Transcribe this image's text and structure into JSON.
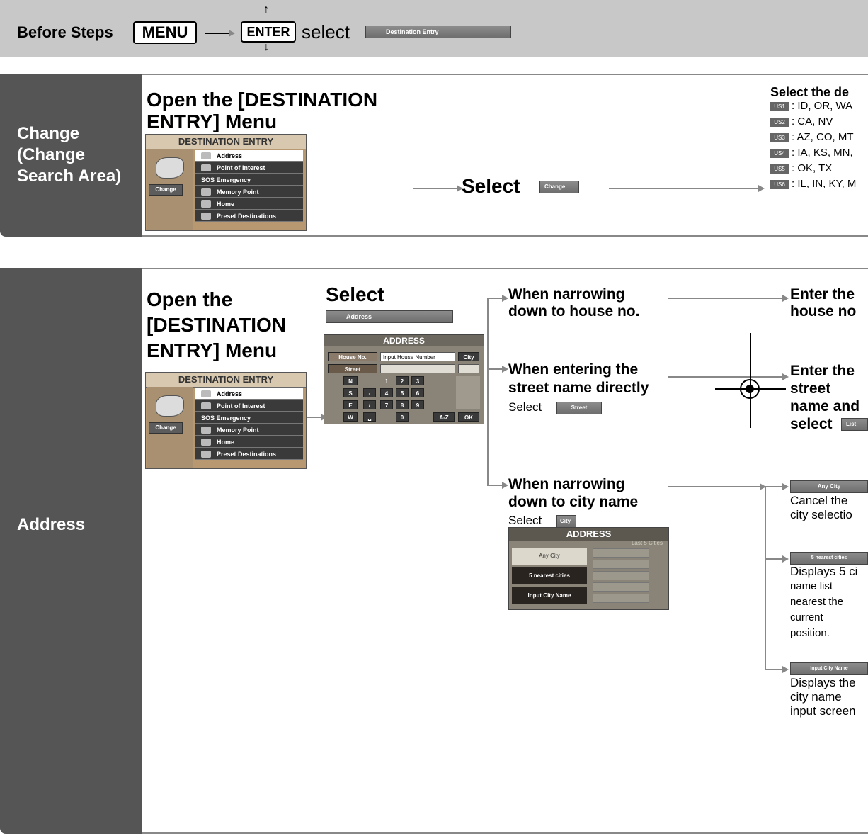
{
  "before_steps": {
    "label": "Before Steps",
    "menu_key": "MENU",
    "enter_key": "ENTER",
    "select_word": "select",
    "dest_button": "Destination Entry"
  },
  "change_section": {
    "side_label_1": "Change",
    "side_label_2": "(Change",
    "side_label_3": "Search Area)",
    "heading_1": "Open the [DESTINATION",
    "heading_2": "ENTRY] Menu",
    "select_word": "Select",
    "change_button": "Change",
    "right_heading": "Select the de",
    "regions": [
      {
        "tag": "US1",
        "text": ": ID, OR, WA"
      },
      {
        "tag": "US2",
        "text": ": CA, NV"
      },
      {
        "tag": "US3",
        "text": ": AZ, CO, MT"
      },
      {
        "tag": "US4",
        "text": ": IA, KS, MN,"
      },
      {
        "tag": "US5",
        "text": ": OK, TX"
      },
      {
        "tag": "US6",
        "text": ": IL, IN, KY, M"
      }
    ]
  },
  "dest_menu": {
    "title": "DESTINATION ENTRY",
    "change": "Change",
    "items": [
      "Address",
      "Point of Interest",
      "Emergency",
      "Memory Point",
      "Home",
      "Preset Destinations"
    ],
    "sos": "SOS"
  },
  "address_section": {
    "side_label": "Address",
    "heading_1": "Open the",
    "heading_2": "[DESTINATION",
    "heading_3": "ENTRY] Menu",
    "select_heading": "Select",
    "address_button": "Address",
    "branch_house_1": "When narrowing",
    "branch_house_2": "down to house no.",
    "branch_street_1": "When entering the",
    "branch_street_2": "street name directly",
    "branch_street_select": "Select",
    "street_button": "Street",
    "branch_city_1": "When narrowing",
    "branch_city_2": "down to city name",
    "branch_city_select": "Select",
    "city_button": "City",
    "enter_house_1": "Enter the",
    "enter_house_2": "house no",
    "enter_street_1": "Enter the",
    "enter_street_2": "street",
    "enter_street_3": "name and",
    "enter_street_4": "select",
    "list_button": "List",
    "any_city_button": "Any City",
    "any_city_desc_1": "Cancel the",
    "any_city_desc_2": "city selectio",
    "nearest_button": "5 nearest cities",
    "nearest_desc_1": "Displays 5 ci",
    "nearest_desc_2": "name list",
    "nearest_desc_3": "nearest the",
    "nearest_desc_4": "current",
    "nearest_desc_5": "position.",
    "input_city_button": "Input City Name",
    "input_desc_1": "Displays the",
    "input_desc_2": "city name",
    "input_desc_3": "input screen"
  },
  "address_keypad": {
    "title": "ADDRESS",
    "house_no": "House No.",
    "house_placeholder": "Input House Number",
    "city": "City",
    "street": "Street",
    "keys_row1": [
      "N",
      "1",
      "2",
      "3"
    ],
    "keys_row2": [
      "S",
      "-",
      "4",
      "5",
      "6"
    ],
    "keys_row3": [
      "E",
      "/",
      "7",
      "8",
      "9"
    ],
    "keys_row4": [
      "W",
      "␣",
      "0"
    ],
    "az": "A-Z",
    "ok": "OK"
  },
  "address_city": {
    "title": "ADDRESS",
    "last5": "Last 5 Cities",
    "any_city": "Any City",
    "nearest": "5 nearest cities",
    "input_city": "Input City Name"
  }
}
